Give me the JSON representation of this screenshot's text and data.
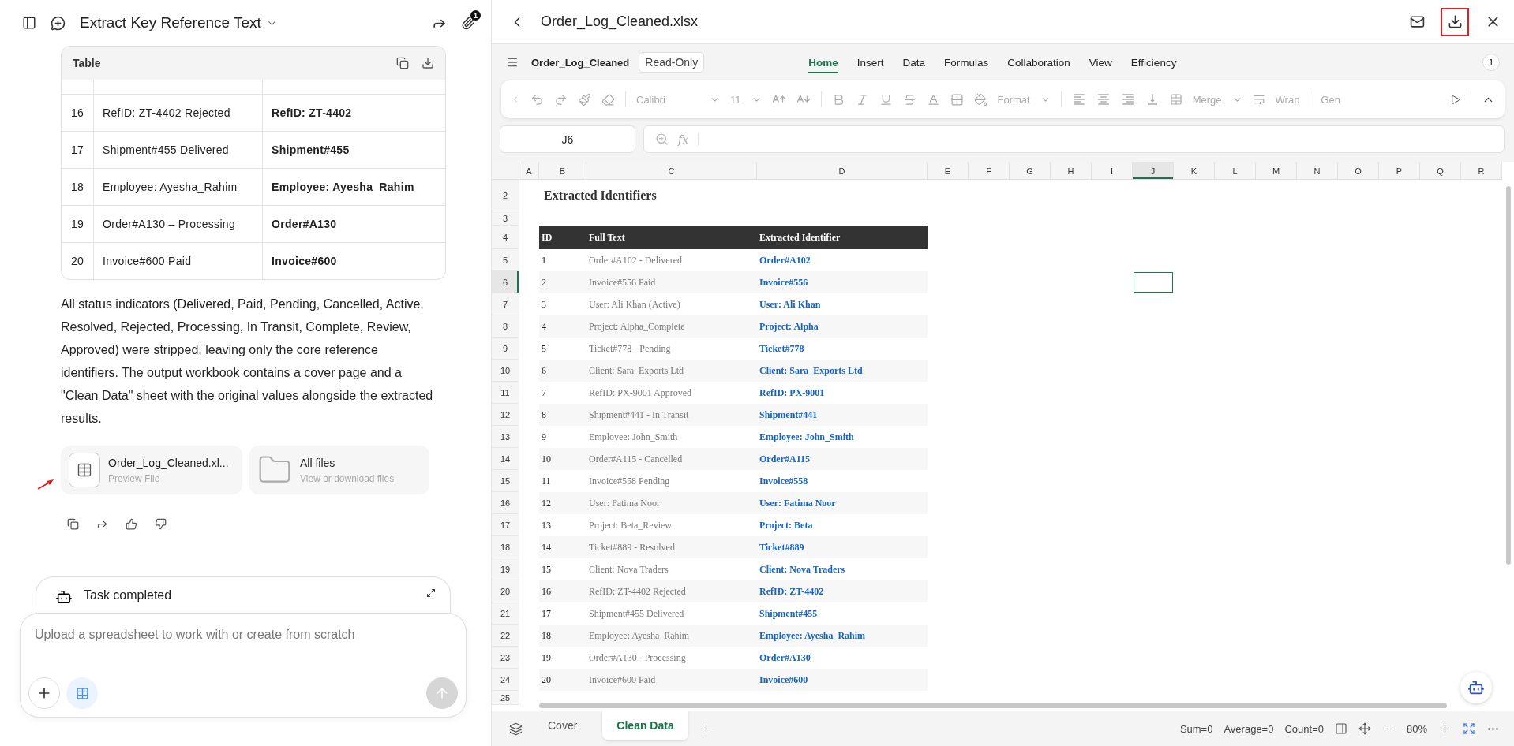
{
  "chat": {
    "title": "Extract Key Reference Text",
    "attachment_badge": "1",
    "table": {
      "title": "Table",
      "rows": [
        {
          "id": "16",
          "full_text": "RefID: ZT-4402 Rejected",
          "identifier": "RefID: ZT-4402"
        },
        {
          "id": "17",
          "full_text": "Shipment#455 Delivered",
          "identifier": "Shipment#455"
        },
        {
          "id": "18",
          "full_text": "Employee: Ayesha_Rahim",
          "identifier": "Employee: Ayesha_Rahim"
        },
        {
          "id": "19",
          "full_text": "Order#A130 – Processing",
          "identifier": "Order#A130"
        },
        {
          "id": "20",
          "full_text": "Invoice#600 Paid",
          "identifier": "Invoice#600"
        }
      ]
    },
    "summary": "All status indicators (Delivered, Paid, Pending, Cancelled, Active, Resolved, Rejected, Processing, In Transit, Complete, Review, Approved) were stripped, leaving only the core reference identifiers. The output workbook contains a cover page and a \"Clean Data\" sheet with the original values alongside the extracted results.",
    "files": [
      {
        "kind": "spreadsheet",
        "name": "Order_Log_Cleaned.xl...",
        "subtitle": "Preview File"
      },
      {
        "kind": "folder",
        "name": "All files",
        "subtitle": "View or download files"
      }
    ],
    "task": {
      "label": "Task completed"
    },
    "composer": {
      "placeholder": "Upload a spreadsheet to work with or create from scratch"
    }
  },
  "viewer": {
    "file_name": "Order_Log_Cleaned.xlsx",
    "download_highlighted": true,
    "workbook": "Order_Log_Cleaned",
    "mode": "Read-Only",
    "menu_tabs": [
      {
        "label": "Home",
        "selected": true
      },
      {
        "label": "Insert",
        "selected": false
      },
      {
        "label": "Data",
        "selected": false
      },
      {
        "label": "Formulas",
        "selected": false
      },
      {
        "label": "Collaboration",
        "selected": false
      },
      {
        "label": "View",
        "selected": false
      },
      {
        "label": "Efficiency",
        "selected": false
      }
    ],
    "collaborators": "1",
    "toolbar": {
      "font": "Calibri",
      "size": "11",
      "format": "Format",
      "merge": "Merge",
      "wrap": "Wrap",
      "number_format": "Gen"
    },
    "cell_ref": "J6",
    "fx": "fx",
    "columns": [
      {
        "label": "A",
        "selected": false
      },
      {
        "label": "B",
        "selected": false
      },
      {
        "label": "C",
        "selected": false
      },
      {
        "label": "D",
        "selected": false
      },
      {
        "label": "E",
        "selected": false
      },
      {
        "label": "F",
        "selected": false
      },
      {
        "label": "G",
        "selected": false
      },
      {
        "label": "H",
        "selected": false
      },
      {
        "label": "I",
        "selected": false
      },
      {
        "label": "J",
        "selected": true
      },
      {
        "label": "K",
        "selected": false
      },
      {
        "label": "L",
        "selected": false
      },
      {
        "label": "M",
        "selected": false
      },
      {
        "label": "N",
        "selected": false
      },
      {
        "label": "O",
        "selected": false
      },
      {
        "label": "P",
        "selected": false
      },
      {
        "label": "Q",
        "selected": false
      },
      {
        "label": "R",
        "selected": false
      }
    ],
    "rows": [
      {
        "number": "2",
        "kind": "title",
        "selected": false,
        "text": "Extracted Identifiers"
      },
      {
        "number": "3",
        "kind": "blank",
        "selected": false
      },
      {
        "number": "4",
        "kind": "header",
        "selected": false,
        "cells": [
          "ID",
          "Full Text",
          "Extracted Identifier"
        ]
      },
      {
        "number": "5",
        "kind": "record",
        "selected": false,
        "id": "1",
        "full_text": "Order#A102 - Delivered",
        "identifier": "Order#A102"
      },
      {
        "number": "6",
        "kind": "record",
        "selected": true,
        "id": "2",
        "full_text": "Invoice#556 Paid",
        "identifier": "Invoice#556"
      },
      {
        "number": "7",
        "kind": "record",
        "selected": false,
        "id": "3",
        "full_text": "User: Ali Khan (Active)",
        "identifier": "User: Ali Khan"
      },
      {
        "number": "8",
        "kind": "record",
        "selected": false,
        "id": "4",
        "full_text": "Project: Alpha_Complete",
        "identifier": "Project: Alpha"
      },
      {
        "number": "9",
        "kind": "record",
        "selected": false,
        "id": "5",
        "full_text": "Ticket#778 - Pending",
        "identifier": "Ticket#778"
      },
      {
        "number": "10",
        "kind": "record",
        "selected": false,
        "id": "6",
        "full_text": "Client: Sara_Exports Ltd",
        "identifier": "Client: Sara_Exports Ltd"
      },
      {
        "number": "11",
        "kind": "record",
        "selected": false,
        "id": "7",
        "full_text": "RefID: PX-9001 Approved",
        "identifier": "RefID: PX-9001"
      },
      {
        "number": "12",
        "kind": "record",
        "selected": false,
        "id": "8",
        "full_text": "Shipment#441 - In Transit",
        "identifier": "Shipment#441"
      },
      {
        "number": "13",
        "kind": "record",
        "selected": false,
        "id": "9",
        "full_text": "Employee: John_Smith",
        "identifier": "Employee: John_Smith"
      },
      {
        "number": "14",
        "kind": "record",
        "selected": false,
        "id": "10",
        "full_text": "Order#A115 - Cancelled",
        "identifier": "Order#A115"
      },
      {
        "number": "15",
        "kind": "record",
        "selected": false,
        "id": "11",
        "full_text": "Invoice#558 Pending",
        "identifier": "Invoice#558"
      },
      {
        "number": "16",
        "kind": "record",
        "selected": false,
        "id": "12",
        "full_text": "User: Fatima Noor",
        "identifier": "User: Fatima Noor"
      },
      {
        "number": "17",
        "kind": "record",
        "selected": false,
        "id": "13",
        "full_text": "Project: Beta_Review",
        "identifier": "Project: Beta"
      },
      {
        "number": "18",
        "kind": "record",
        "selected": false,
        "id": "14",
        "full_text": "Ticket#889 - Resolved",
        "identifier": "Ticket#889"
      },
      {
        "number": "19",
        "kind": "record",
        "selected": false,
        "id": "15",
        "full_text": "Client: Nova Traders",
        "identifier": "Client: Nova Traders"
      },
      {
        "number": "20",
        "kind": "record",
        "selected": false,
        "id": "16",
        "full_text": "RefID: ZT-4402 Rejected",
        "identifier": "RefID: ZT-4402"
      },
      {
        "number": "21",
        "kind": "record",
        "selected": false,
        "id": "17",
        "full_text": "Shipment#455 Delivered",
        "identifier": "Shipment#455"
      },
      {
        "number": "22",
        "kind": "record",
        "selected": false,
        "id": "18",
        "full_text": "Employee: Ayesha_Rahim",
        "identifier": "Employee: Ayesha_Rahim"
      },
      {
        "number": "23",
        "kind": "record",
        "selected": false,
        "id": "19",
        "full_text": "Order#A130 - Processing",
        "identifier": "Order#A130"
      },
      {
        "number": "24",
        "kind": "record",
        "selected": false,
        "id": "20",
        "full_text": "Invoice#600 Paid",
        "identifier": "Invoice#600"
      },
      {
        "number": "25",
        "kind": "blank",
        "selected": false
      }
    ],
    "sheet_tabs": [
      {
        "label": "Cover",
        "selected": false
      },
      {
        "label": "Clean Data",
        "selected": true
      }
    ],
    "status": {
      "sum": "Sum=0",
      "average": "Average=0",
      "count": "Count=0",
      "zoom": "80%"
    }
  }
}
